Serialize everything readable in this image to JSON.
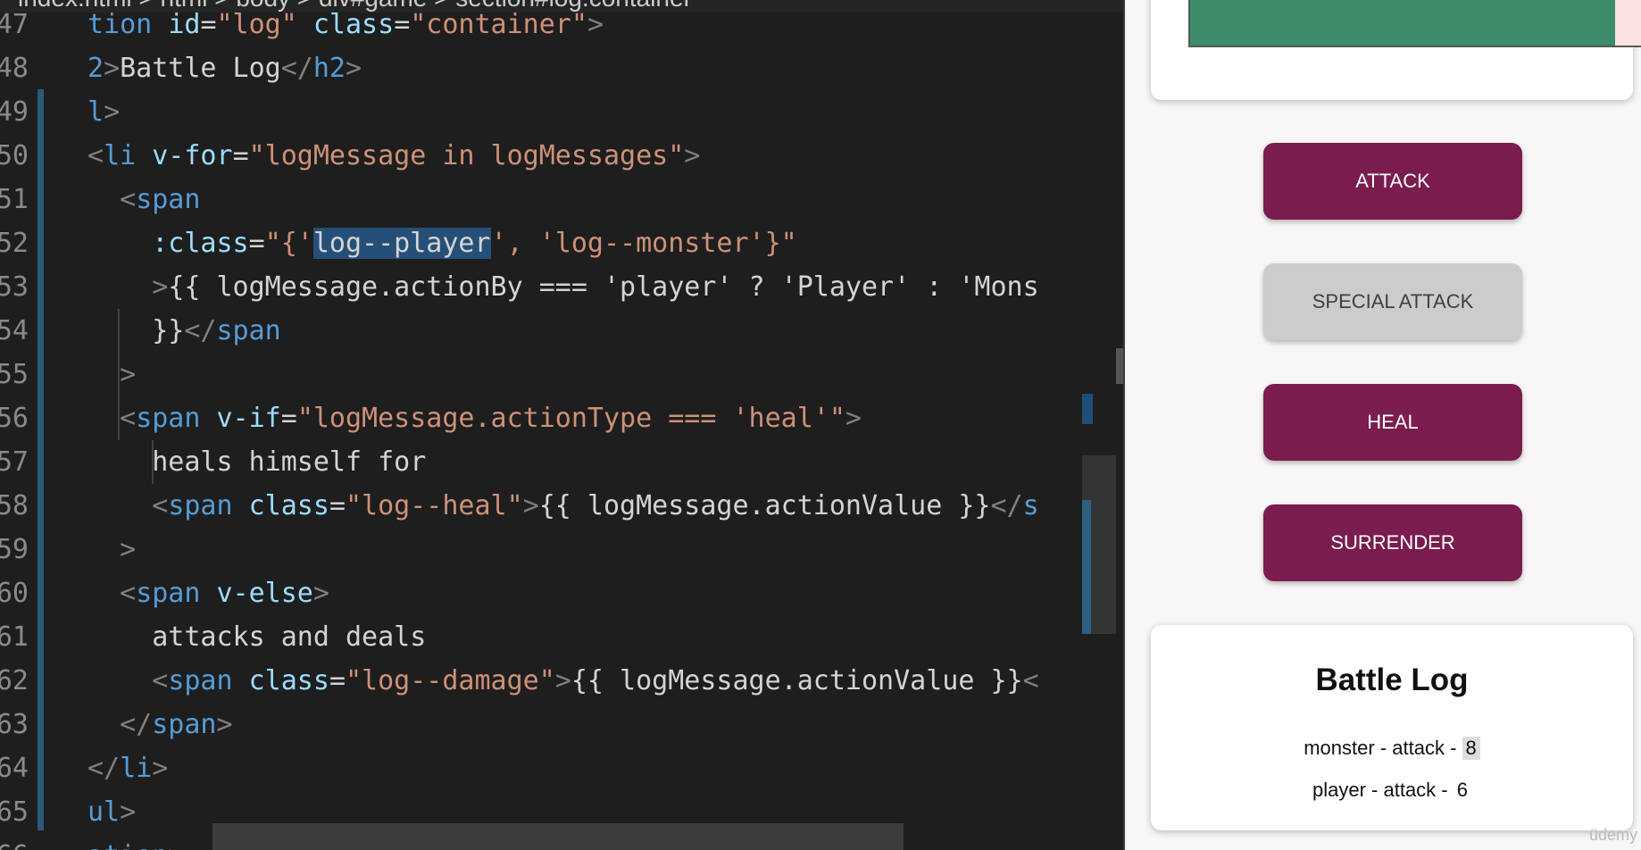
{
  "editor": {
    "breadcrumb": "index.html > html > body > div#game > section#log.container",
    "lines": [
      {
        "n": "47",
        "tokens": [
          [
            "tag",
            "tion "
          ],
          [
            "attr",
            "id"
          ],
          [
            "txt",
            "="
          ],
          [
            "str",
            "\"log\" "
          ],
          [
            "attr",
            "class"
          ],
          [
            "txt",
            "="
          ],
          [
            "str",
            "\"container\""
          ],
          [
            "br",
            ">"
          ]
        ]
      },
      {
        "n": "48",
        "tokens": [
          [
            "tag",
            "2"
          ],
          [
            "br",
            ">"
          ],
          [
            "txt",
            "Battle Log"
          ],
          [
            "br",
            "</"
          ],
          [
            "tag",
            "h2"
          ],
          [
            "br",
            ">"
          ]
        ]
      },
      {
        "n": "49",
        "tokens": [
          [
            "tag",
            "l"
          ],
          [
            "br",
            ">"
          ]
        ]
      },
      {
        "n": "50",
        "tokens": [
          [
            "br",
            "<"
          ],
          [
            "tag",
            "li "
          ],
          [
            "attr",
            "v-for"
          ],
          [
            "txt",
            "="
          ],
          [
            "str",
            "\"logMessage in logMessages\""
          ],
          [
            "br",
            ">"
          ]
        ]
      },
      {
        "n": "51",
        "tokens": [
          [
            "txt",
            "  "
          ],
          [
            "br",
            "<"
          ],
          [
            "tag",
            "span"
          ]
        ]
      },
      {
        "n": "52",
        "tokens": [
          [
            "txt",
            "    "
          ],
          [
            "attr",
            ":class"
          ],
          [
            "txt",
            "="
          ],
          [
            "str",
            "\"{'"
          ],
          [
            "sel",
            "log--player"
          ],
          [
            "str",
            "', 'log--monster'}\""
          ]
        ]
      },
      {
        "n": "53",
        "tokens": [
          [
            "txt",
            "    "
          ],
          [
            "br",
            ">"
          ],
          [
            "txt",
            "{{ logMessage.actionBy === 'player' ? 'Player' : 'Mons"
          ]
        ]
      },
      {
        "n": "54",
        "tokens": [
          [
            "txt",
            "    }}"
          ],
          [
            "br",
            "</"
          ],
          [
            "tag",
            "span"
          ]
        ]
      },
      {
        "n": "55",
        "tokens": [
          [
            "txt",
            "  "
          ],
          [
            "br",
            ">"
          ]
        ]
      },
      {
        "n": "56",
        "tokens": [
          [
            "txt",
            "  "
          ],
          [
            "br",
            "<"
          ],
          [
            "tag",
            "span "
          ],
          [
            "attr",
            "v-if"
          ],
          [
            "txt",
            "="
          ],
          [
            "str",
            "\"logMessage.actionType === 'heal'\""
          ],
          [
            "br",
            ">"
          ]
        ]
      },
      {
        "n": "57",
        "tokens": [
          [
            "txt",
            "    heals himself for"
          ]
        ]
      },
      {
        "n": "58",
        "tokens": [
          [
            "txt",
            "    "
          ],
          [
            "br",
            "<"
          ],
          [
            "tag",
            "span "
          ],
          [
            "attr",
            "class"
          ],
          [
            "txt",
            "="
          ],
          [
            "str",
            "\"log--heal\""
          ],
          [
            "br",
            ">"
          ],
          [
            "txt",
            "{{ logMessage.actionValue }}"
          ],
          [
            "br",
            "</"
          ],
          [
            "tag",
            "s"
          ]
        ]
      },
      {
        "n": "59",
        "tokens": [
          [
            "txt",
            "  "
          ],
          [
            "br",
            ">"
          ]
        ]
      },
      {
        "n": "60",
        "tokens": [
          [
            "txt",
            "  "
          ],
          [
            "br",
            "<"
          ],
          [
            "tag",
            "span "
          ],
          [
            "attr",
            "v-else"
          ],
          [
            "br",
            ">"
          ]
        ]
      },
      {
        "n": "61",
        "tokens": [
          [
            "txt",
            "    attacks and deals"
          ]
        ]
      },
      {
        "n": "62",
        "tokens": [
          [
            "txt",
            "    "
          ],
          [
            "br",
            "<"
          ],
          [
            "tag",
            "span "
          ],
          [
            "attr",
            "class"
          ],
          [
            "txt",
            "="
          ],
          [
            "str",
            "\"log--damage\""
          ],
          [
            "br",
            ">"
          ],
          [
            "txt",
            "{{ logMessage.actionValue }}"
          ],
          [
            "br",
            "<"
          ]
        ]
      },
      {
        "n": "63",
        "tokens": [
          [
            "txt",
            "  "
          ],
          [
            "br",
            "</"
          ],
          [
            "tag",
            "span"
          ],
          [
            "br",
            ">"
          ]
        ]
      },
      {
        "n": "64",
        "tokens": [
          [
            "br",
            "</"
          ],
          [
            "tag",
            "li"
          ],
          [
            "br",
            ">"
          ]
        ]
      },
      {
        "n": "65",
        "tokens": [
          [
            "tag",
            "ul"
          ],
          [
            "br",
            ">"
          ]
        ]
      },
      {
        "n": "66",
        "tokens": [
          [
            "tag",
            "ation"
          ],
          [
            "br",
            ">"
          ]
        ]
      }
    ]
  },
  "preview": {
    "health_fraction": 0.93,
    "colors": {
      "primary": "#7a1c4d",
      "disabled": "#cccccc",
      "health": "#3a8d68",
      "health_bg": "#fde2e2"
    },
    "buttons": [
      {
        "label": "ATTACK",
        "style": "primary"
      },
      {
        "label": "SPECIAL ATTACK",
        "style": "disabled"
      },
      {
        "label": "HEAL",
        "style": "primary"
      },
      {
        "label": "SURRENDER",
        "style": "primary"
      }
    ],
    "log": {
      "title": "Battle Log",
      "entries": [
        {
          "prefix": "monster - attack - ",
          "value": "8",
          "highlight": true
        },
        {
          "prefix": "player - attack - ",
          "value": "6",
          "highlight": false
        }
      ]
    },
    "watermark": "üdemy"
  }
}
